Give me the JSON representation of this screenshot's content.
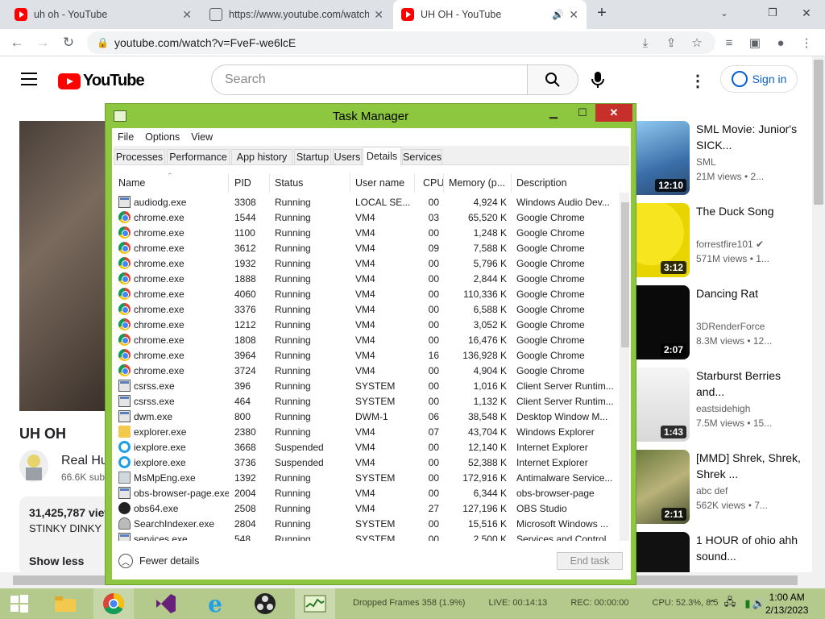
{
  "browser": {
    "tabs": [
      {
        "title": "uh oh - YouTube",
        "active": false
      },
      {
        "title": "https://www.youtube.com/watch",
        "active": false
      },
      {
        "title": "UH OH - YouTube",
        "active": true
      }
    ],
    "url": "youtube.com/watch?v=FveF-we6lcE"
  },
  "youtube": {
    "logo_text": "YouTube",
    "search_placeholder": "Search",
    "signin_label": "Sign in",
    "video_title": "UH OH",
    "channel_name": "Real Hu",
    "channel_subs": "66.6K sub",
    "views": "31,425,787 view",
    "description": "STINKY DINKY",
    "show_less": "Show less",
    "recommendations": [
      {
        "title": "SML Movie: Junior's SICK...",
        "channel": "SML",
        "views": "21M views • 2...",
        "duration": "12:10",
        "verified": false
      },
      {
        "title": "The Duck Song",
        "channel": "forrestfire101",
        "views": "571M views • 1...",
        "duration": "3:12",
        "verified": true
      },
      {
        "title": "Dancing Rat",
        "channel": "3DRenderForce",
        "views": "8.3M views • 12...",
        "duration": "2:07",
        "verified": false
      },
      {
        "title": "Starburst Berries and...",
        "channel": "eastsidehigh",
        "views": "7.5M views • 15...",
        "duration": "1:43",
        "verified": false
      },
      {
        "title": "[MMD] Shrek, Shrek, Shrek ...",
        "channel": "abc def",
        "views": "562K views • 7...",
        "duration": "2:11",
        "verified": false
      },
      {
        "title": "1 HOUR of ohio ahh sound...",
        "channel": "",
        "views": "",
        "duration": "",
        "verified": false
      }
    ]
  },
  "task_manager": {
    "title": "Task Manager",
    "menu": [
      "File",
      "Options",
      "View"
    ],
    "tabs": [
      "Processes",
      "Performance",
      "App history",
      "Startup",
      "Users",
      "Details",
      "Services"
    ],
    "active_tab": "Details",
    "columns": [
      "Name",
      "PID",
      "Status",
      "User name",
      "CPU",
      "Memory (p...",
      "Description"
    ],
    "rows": [
      {
        "icon": "sys",
        "name": "audiodg.exe",
        "pid": "3308",
        "status": "Running",
        "user": "LOCAL SE...",
        "cpu": "00",
        "mem": "4,924 K",
        "desc": "Windows Audio Dev..."
      },
      {
        "icon": "chrome",
        "name": "chrome.exe",
        "pid": "1544",
        "status": "Running",
        "user": "VM4",
        "cpu": "03",
        "mem": "65,520 K",
        "desc": "Google Chrome"
      },
      {
        "icon": "chrome",
        "name": "chrome.exe",
        "pid": "1100",
        "status": "Running",
        "user": "VM4",
        "cpu": "00",
        "mem": "1,248 K",
        "desc": "Google Chrome"
      },
      {
        "icon": "chrome",
        "name": "chrome.exe",
        "pid": "3612",
        "status": "Running",
        "user": "VM4",
        "cpu": "09",
        "mem": "7,588 K",
        "desc": "Google Chrome"
      },
      {
        "icon": "chrome",
        "name": "chrome.exe",
        "pid": "1932",
        "status": "Running",
        "user": "VM4",
        "cpu": "00",
        "mem": "5,796 K",
        "desc": "Google Chrome"
      },
      {
        "icon": "chrome",
        "name": "chrome.exe",
        "pid": "1888",
        "status": "Running",
        "user": "VM4",
        "cpu": "00",
        "mem": "2,844 K",
        "desc": "Google Chrome"
      },
      {
        "icon": "chrome",
        "name": "chrome.exe",
        "pid": "4060",
        "status": "Running",
        "user": "VM4",
        "cpu": "00",
        "mem": "110,336 K",
        "desc": "Google Chrome"
      },
      {
        "icon": "chrome",
        "name": "chrome.exe",
        "pid": "3376",
        "status": "Running",
        "user": "VM4",
        "cpu": "00",
        "mem": "6,588 K",
        "desc": "Google Chrome"
      },
      {
        "icon": "chrome",
        "name": "chrome.exe",
        "pid": "1212",
        "status": "Running",
        "user": "VM4",
        "cpu": "00",
        "mem": "3,052 K",
        "desc": "Google Chrome"
      },
      {
        "icon": "chrome",
        "name": "chrome.exe",
        "pid": "1808",
        "status": "Running",
        "user": "VM4",
        "cpu": "00",
        "mem": "16,476 K",
        "desc": "Google Chrome"
      },
      {
        "icon": "chrome",
        "name": "chrome.exe",
        "pid": "3964",
        "status": "Running",
        "user": "VM4",
        "cpu": "16",
        "mem": "136,928 K",
        "desc": "Google Chrome"
      },
      {
        "icon": "chrome",
        "name": "chrome.exe",
        "pid": "3724",
        "status": "Running",
        "user": "VM4",
        "cpu": "00",
        "mem": "4,904 K",
        "desc": "Google Chrome"
      },
      {
        "icon": "sys",
        "name": "csrss.exe",
        "pid": "396",
        "status": "Running",
        "user": "SYSTEM",
        "cpu": "00",
        "mem": "1,016 K",
        "desc": "Client Server Runtim..."
      },
      {
        "icon": "sys",
        "name": "csrss.exe",
        "pid": "464",
        "status": "Running",
        "user": "SYSTEM",
        "cpu": "00",
        "mem": "1,132 K",
        "desc": "Client Server Runtim..."
      },
      {
        "icon": "sys",
        "name": "dwm.exe",
        "pid": "800",
        "status": "Running",
        "user": "DWM-1",
        "cpu": "06",
        "mem": "38,548 K",
        "desc": "Desktop Window M..."
      },
      {
        "icon": "folder",
        "name": "explorer.exe",
        "pid": "2380",
        "status": "Running",
        "user": "VM4",
        "cpu": "07",
        "mem": "43,704 K",
        "desc": "Windows Explorer"
      },
      {
        "icon": "ie",
        "name": "iexplore.exe",
        "pid": "3668",
        "status": "Suspended",
        "user": "VM4",
        "cpu": "00",
        "mem": "12,140 K",
        "desc": "Internet Explorer"
      },
      {
        "icon": "ie",
        "name": "iexplore.exe",
        "pid": "3736",
        "status": "Suspended",
        "user": "VM4",
        "cpu": "00",
        "mem": "52,388 K",
        "desc": "Internet Explorer"
      },
      {
        "icon": "shield",
        "name": "MsMpEng.exe",
        "pid": "1392",
        "status": "Running",
        "user": "SYSTEM",
        "cpu": "00",
        "mem": "172,916 K",
        "desc": "Antimalware Service..."
      },
      {
        "icon": "sys",
        "name": "obs-browser-page.exe",
        "pid": "2004",
        "status": "Running",
        "user": "VM4",
        "cpu": "00",
        "mem": "6,344 K",
        "desc": "obs-browser-page"
      },
      {
        "icon": "obs",
        "name": "obs64.exe",
        "pid": "2508",
        "status": "Running",
        "user": "VM4",
        "cpu": "27",
        "mem": "127,196 K",
        "desc": "OBS Studio"
      },
      {
        "icon": "search",
        "name": "SearchIndexer.exe",
        "pid": "2804",
        "status": "Running",
        "user": "SYSTEM",
        "cpu": "00",
        "mem": "15,516 K",
        "desc": "Microsoft Windows ..."
      },
      {
        "icon": "sys",
        "name": "services.exe",
        "pid": "548",
        "status": "Running",
        "user": "SYSTEM",
        "cpu": "00",
        "mem": "2,500 K",
        "desc": "Services and Control..."
      }
    ],
    "fewer_details": "Fewer details",
    "end_task": "End task"
  },
  "taskbar": {
    "obs_status": {
      "dropped": "Dropped Frames 358 (1.9%)",
      "live": "LIVE: 00:14:13",
      "rec": "REC: 00:00:00",
      "cpu": "CPU: 52.3%, 8.5"
    },
    "time": "1:00 AM",
    "date": "2/13/2023"
  }
}
